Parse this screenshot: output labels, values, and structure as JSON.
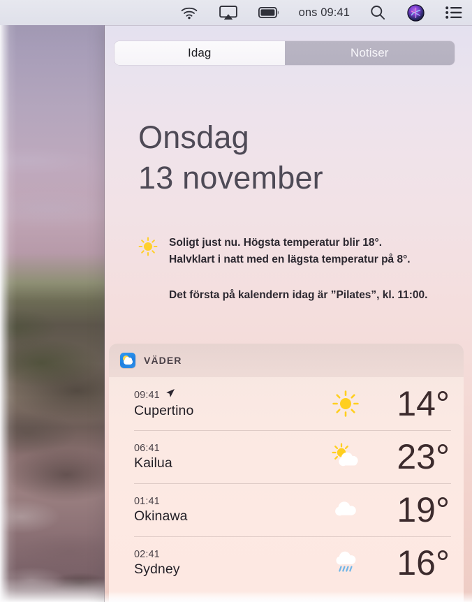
{
  "menubar": {
    "icons": [
      {
        "name": "wifi-icon",
        "label": "Wi-Fi"
      },
      {
        "name": "airplay-icon",
        "label": "AirPlay"
      },
      {
        "name": "battery-icon",
        "label": "Battery"
      }
    ],
    "clock": "ons 09:41",
    "right_icons": [
      {
        "name": "spotlight-search-icon",
        "label": "Spotlight"
      },
      {
        "name": "siri-icon",
        "label": "Siri"
      },
      {
        "name": "notification-center-icon",
        "label": "Notification Center"
      }
    ]
  },
  "notification_center": {
    "tabs": [
      {
        "label": "Idag",
        "selected": true
      },
      {
        "label": "Notiser",
        "selected": false
      }
    ],
    "date": {
      "weekday": "Onsdag",
      "daymonth": "13 november"
    },
    "summary": {
      "icon": "sun-icon",
      "weather_line1": "Soligt just nu. Högsta temperatur blir 18°.",
      "weather_line2": "Halvklart i natt med en lägsta temperatur på 8°.",
      "calendar_line": "Det första på kalendern idag är ”Pilates”, kl. 11:00."
    },
    "weather_widget": {
      "icon": "weather-app-icon",
      "title": "VÄDER",
      "rows": [
        {
          "time": "09:41",
          "city": "Cupertino",
          "temp": "14°",
          "condition": "sunny",
          "has_location_arrow": true
        },
        {
          "time": "06:41",
          "city": "Kailua",
          "temp": "23°",
          "condition": "partly-cloudy",
          "has_location_arrow": false
        },
        {
          "time": "01:41",
          "city": "Okinawa",
          "temp": "19°",
          "condition": "cloudy",
          "has_location_arrow": false
        },
        {
          "time": "02:41",
          "city": "Sydney",
          "temp": "16°",
          "condition": "rainy",
          "has_location_arrow": false
        }
      ]
    }
  },
  "colors": {
    "panel_top": "#e4e1ef",
    "panel_bottom": "#eeccc4",
    "sun_yellow": "#ffd02e",
    "temp_text": "#3c2b2d",
    "widget_icon_blue": "#2f9bf2",
    "rain_blue": "#6fb5e8"
  }
}
